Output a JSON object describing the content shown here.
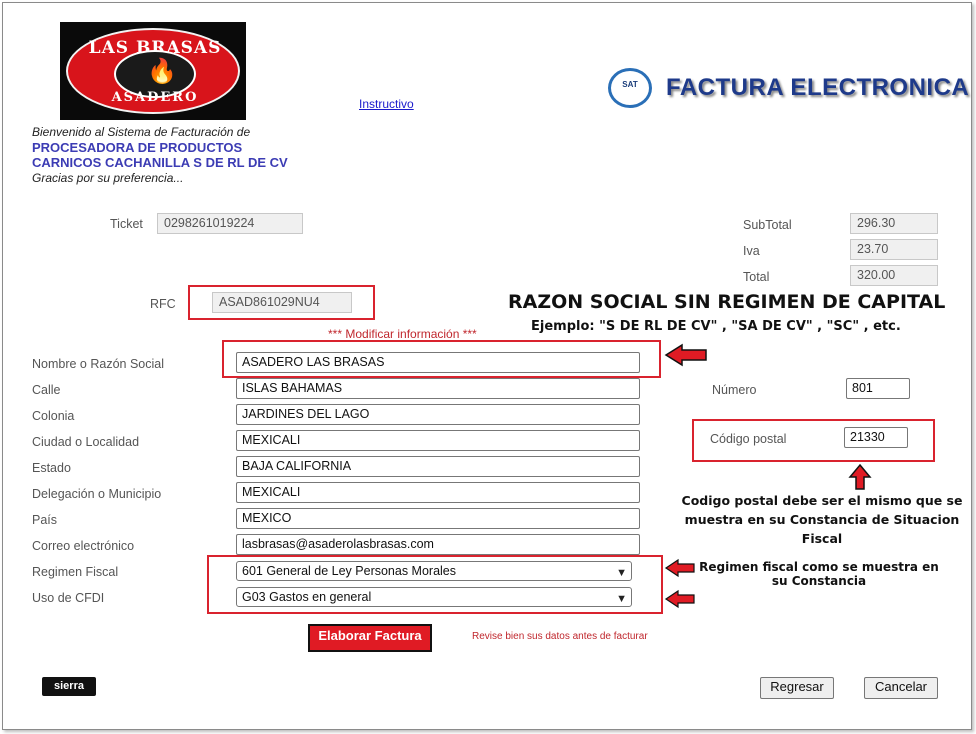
{
  "header": {
    "logo_top": "LAS BRASAS",
    "logo_bottom": "ASADERO",
    "instructivo_link": "Instructivo",
    "welcome": "Bienvenido al Sistema de Facturación de",
    "company_line1": "PROCESADORA DE PRODUCTOS",
    "company_line2": "CARNICOS CACHANILLA S DE RL DE CV",
    "thanks": "Gracias por su preferencia...",
    "sat_badge": "SAT",
    "title": "FACTURA ELECTRONICA"
  },
  "ticket": {
    "label": "Ticket",
    "value": "0298261019224"
  },
  "totals": {
    "subtotal_label": "SubTotal",
    "subtotal_value": "296.30",
    "iva_label": "Iva",
    "iva_value": "23.70",
    "total_label": "Total",
    "total_value": "320.00"
  },
  "rfc": {
    "label": "RFC",
    "value": "ASAD861029NU4"
  },
  "modify_info": "*** Modificar información ***",
  "annotations": {
    "razon_title": "RAZON SOCIAL SIN REGIMEN DE CAPITAL",
    "razon_example": "Ejemplo: \"S DE RL DE CV\" , \"SA DE CV\" , \"SC\" , etc.",
    "cp_note": "Codigo postal debe ser el mismo que se muestra en su Constancia de Situacion Fiscal",
    "regimen_note": "Regimen fiscal como se muestra en su Constancia"
  },
  "form": {
    "razon_social": {
      "label": "Nombre o Razón Social",
      "value": "ASADERO LAS BRASAS"
    },
    "calle": {
      "label": "Calle",
      "value": "ISLAS BAHAMAS"
    },
    "colonia": {
      "label": "Colonia",
      "value": "JARDINES DEL LAGO"
    },
    "ciudad": {
      "label": "Ciudad o Localidad",
      "value": "MEXICALI"
    },
    "estado": {
      "label": "Estado",
      "value": "BAJA CALIFORNIA"
    },
    "delegacion": {
      "label": "Delegación o Municipio",
      "value": "MEXICALI"
    },
    "pais": {
      "label": "País",
      "value": "MEXICO"
    },
    "correo": {
      "label": "Correo electrónico",
      "value": "lasbrasas@asaderolasbrasas.com"
    },
    "regimen": {
      "label": "Regimen Fiscal",
      "selected": "601 General de Ley Personas Morales"
    },
    "uso_cfdi": {
      "label": "Uso de CFDI",
      "selected": "G03 Gastos en general"
    },
    "numero": {
      "label": "Número",
      "value": "801"
    },
    "codigo_postal": {
      "label": "Código postal",
      "value": "21330"
    }
  },
  "actions": {
    "elaborar": "Elaborar Factura",
    "review_hint": "Revise bien sus datos antes de facturar",
    "regresar": "Regresar",
    "cancelar": "Cancelar"
  },
  "footer": {
    "brand": "sierra"
  },
  "colors": {
    "accent_red": "#d9232e",
    "company_blue": "#3c3cb4",
    "title_blue": "#1e3a8a"
  }
}
